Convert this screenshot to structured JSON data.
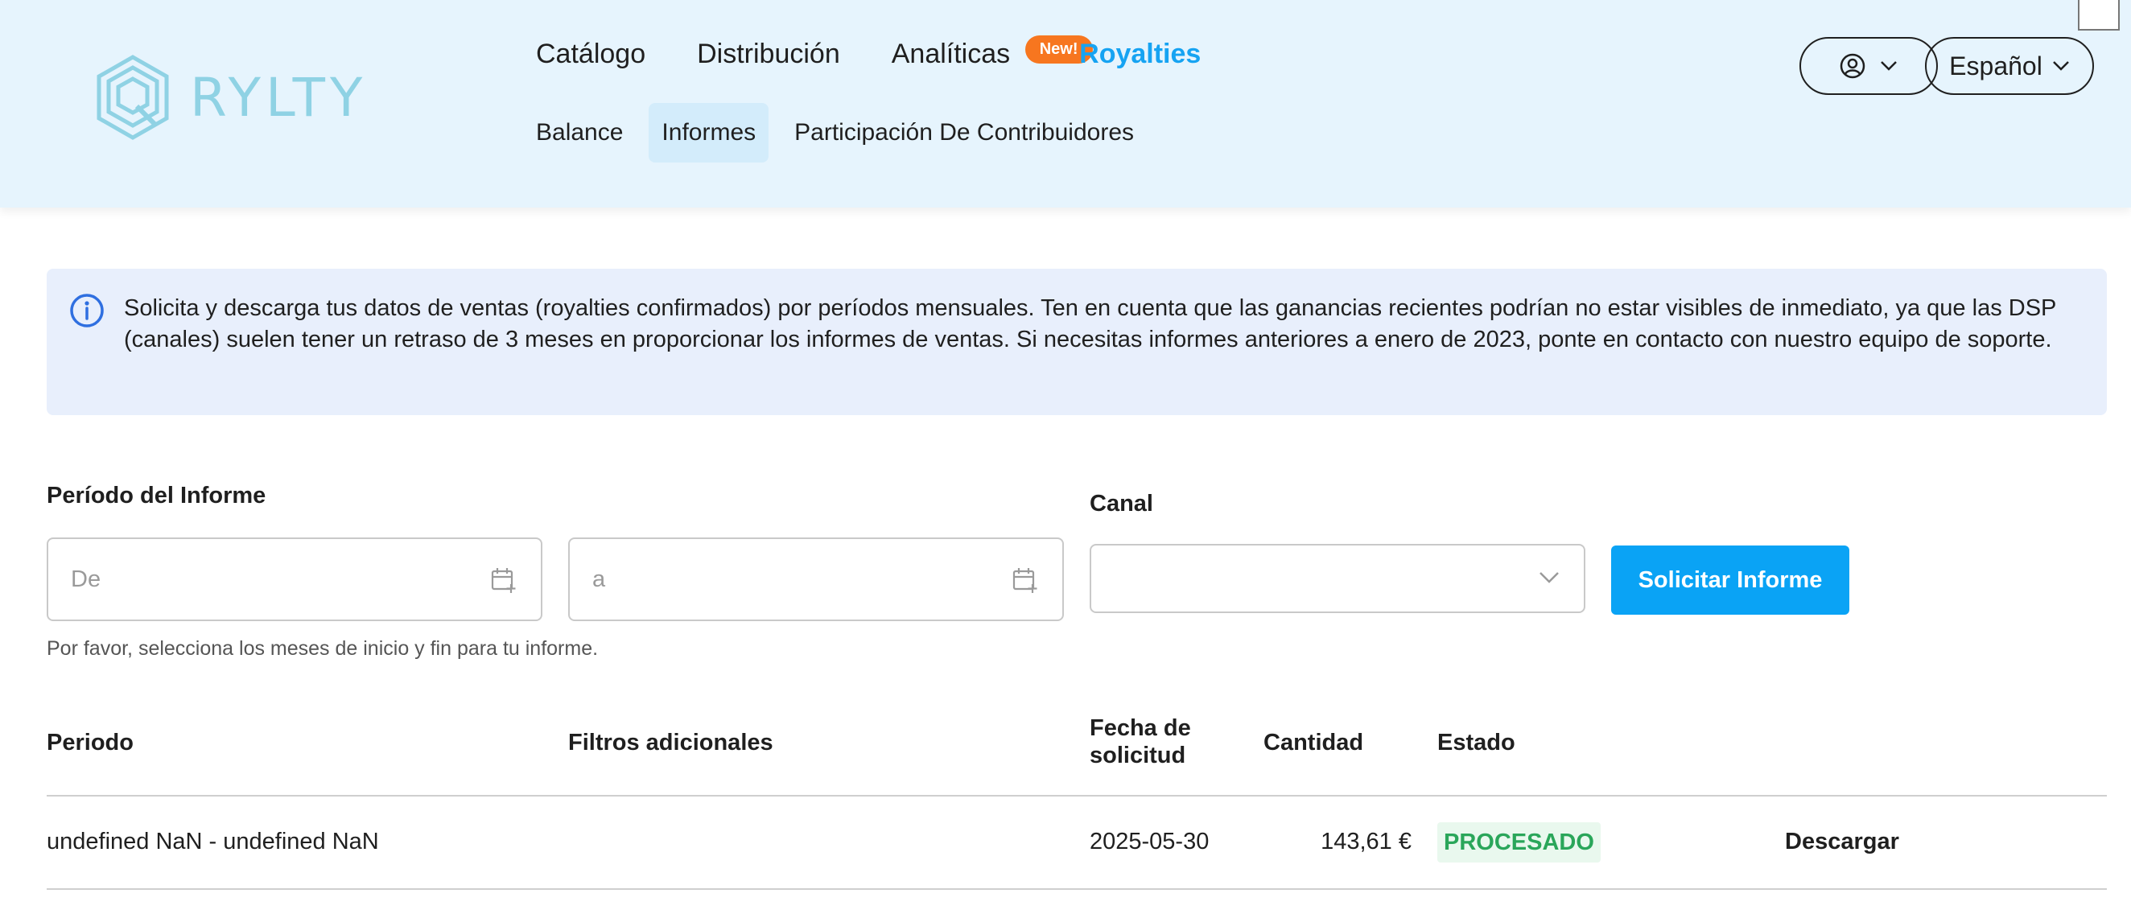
{
  "brand": {
    "name": "RYLTY",
    "logo_color": "#8fd2e4"
  },
  "nav": {
    "top": [
      {
        "label": "Catálogo"
      },
      {
        "label": "Distribución"
      },
      {
        "label": "Analíticas",
        "badge": "New!"
      },
      {
        "label": "Royalties",
        "active": true
      }
    ],
    "sub": [
      {
        "label": "Balance"
      },
      {
        "label": "Informes",
        "selected": true
      },
      {
        "label": "Participación De Contribuidores"
      }
    ],
    "user_menu_icon": "user-circle-icon",
    "language": "Español"
  },
  "info": {
    "icon": "info-icon",
    "text": "Solicita y descarga tus datos de ventas (royalties confirmados) por períodos mensuales. Ten en cuenta que las ganancias recientes podrían no estar visibles de inmediato, ya que las DSP (canales) suelen tener un retraso de 3 meses en proporcionar los informes de ventas. Si necesitas informes anteriores a enero de 2023, ponte en contacto con nuestro equipo de soporte."
  },
  "form": {
    "period_label": "Período del Informe",
    "from_placeholder": "De",
    "to_placeholder": "a",
    "channel_label": "Canal",
    "channel_value": "",
    "submit_label": "Solicitar Informe",
    "hint": "Por favor, selecciona los meses de inicio y fin para tu informe."
  },
  "table": {
    "headers": {
      "period": "Periodo",
      "filters": "Filtros adicionales",
      "request_date_line1": "Fecha de",
      "request_date_line2": "solicitud",
      "amount": "Cantidad",
      "status": "Estado"
    },
    "rows": [
      {
        "period": "undefined NaN - undefined NaN",
        "filters": "",
        "request_date": "2025-05-30",
        "amount": "143,61 €",
        "status": "PROCESADO",
        "action": "Descargar"
      }
    ]
  },
  "colors": {
    "header_bg": "#e6f4fd",
    "accent": "#16a3f2",
    "badge": "#f7761f",
    "info_bg": "#e8effc",
    "status_green": "#2aa65a"
  }
}
